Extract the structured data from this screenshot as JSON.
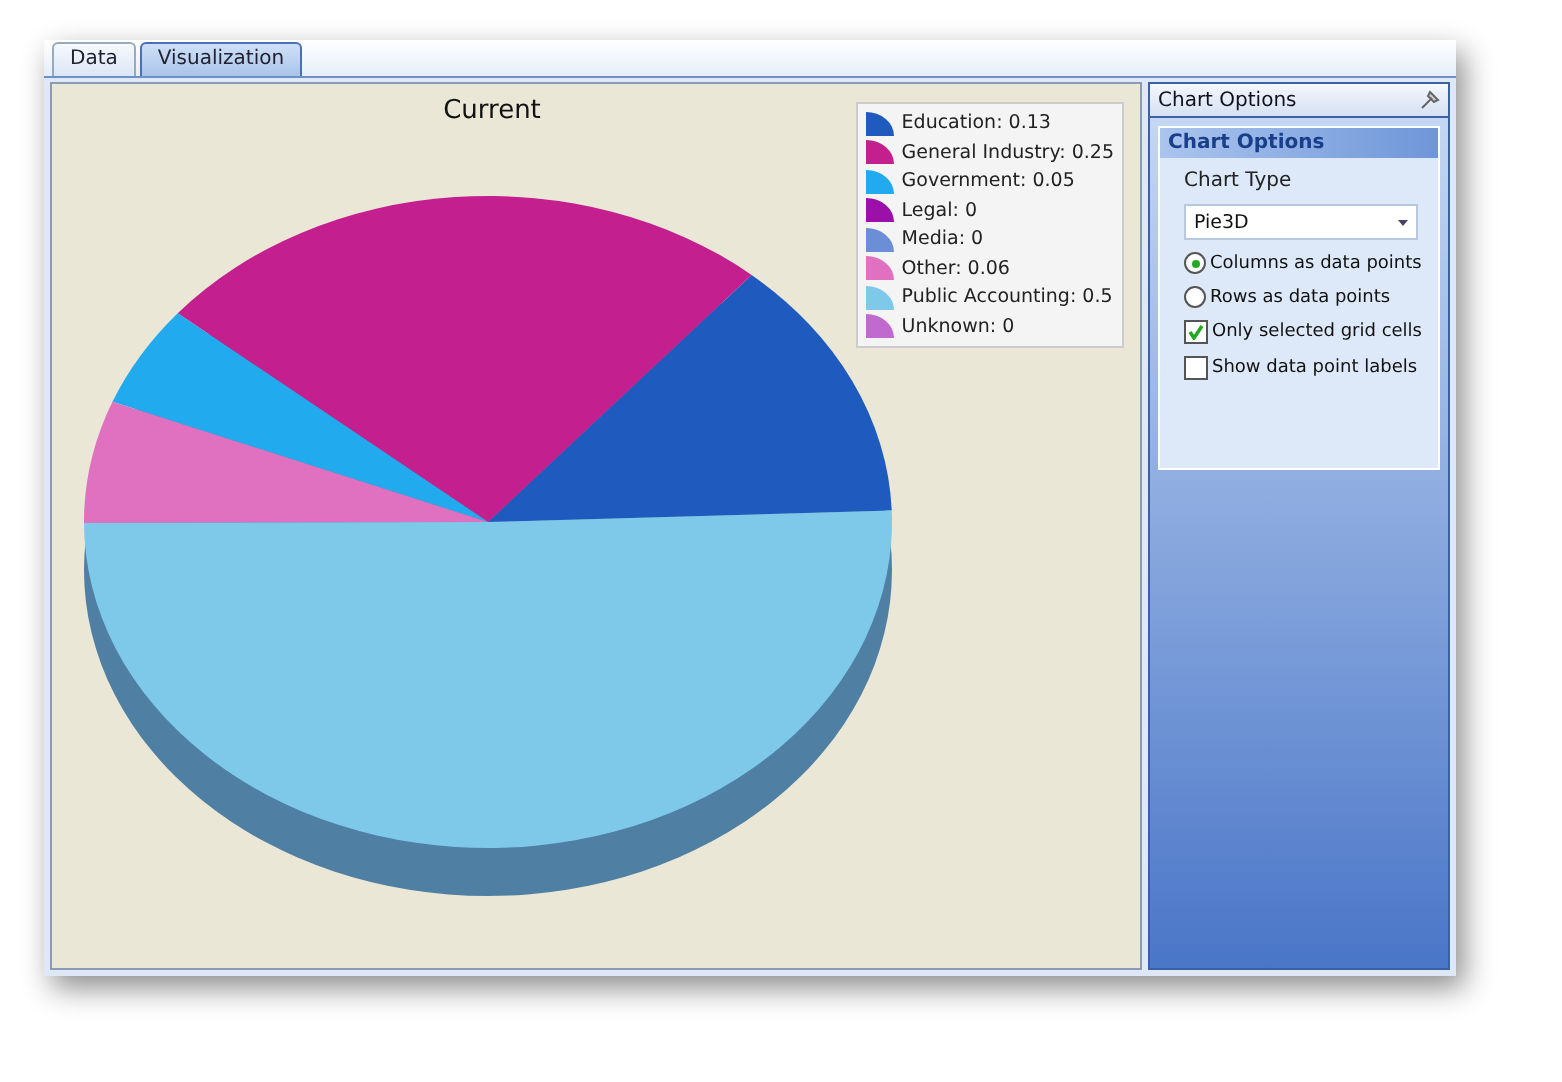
{
  "tabs": [
    {
      "label": "Data",
      "selected": false
    },
    {
      "label": "Visualization",
      "selected": true
    }
  ],
  "chart": {
    "chart_data": {
      "type": "pie",
      "title": "Current",
      "values": [
        0.13,
        0.25,
        0.05,
        0,
        0,
        0.06,
        0.5,
        0
      ]
    },
    "legend": [
      {
        "label": "Education: 0.13",
        "color": "#1f5bbf"
      },
      {
        "label": "General Industry: 0.25",
        "color": "#c41f8f"
      },
      {
        "label": "Government: 0.05",
        "color": "#22aaee"
      },
      {
        "label": "Legal: 0",
        "color": "#9a10a8"
      },
      {
        "label": "Media: 0",
        "color": "#6a8fd6"
      },
      {
        "label": "Other: 0.06",
        "color": "#e070c0"
      },
      {
        "label": "Public Accounting: 0.5",
        "color": "#7ec8ea"
      },
      {
        "label": "Unknown: 0",
        "color": "#c06ad0"
      }
    ]
  },
  "options_panel": {
    "title": "Chart Options",
    "section_title": "Chart Options",
    "chart_type_label": "Chart Type",
    "chart_type_value": "Pie3D",
    "radios": [
      {
        "label": "Columns as data points",
        "selected": true
      },
      {
        "label": "Rows as data points",
        "selected": false
      }
    ],
    "checkboxes": [
      {
        "label": "Only selected grid cells",
        "checked": true
      },
      {
        "label": "Show data point labels",
        "checked": false
      }
    ]
  }
}
